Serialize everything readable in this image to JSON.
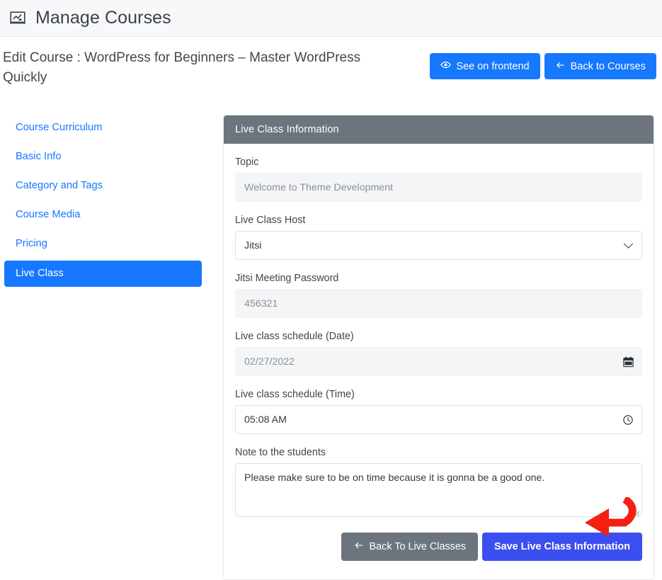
{
  "appbar": {
    "icon": "presentation-chart-icon",
    "title": "Manage Courses"
  },
  "page_header": {
    "title": "Edit Course : WordPress for Beginners – Master WordPress Quickly",
    "actions": [
      {
        "id": "see-on-frontend",
        "label": "See on frontend",
        "icon": "eye-icon",
        "color": "#1677ff"
      },
      {
        "id": "back-to-courses",
        "label": "Back to Courses",
        "icon": "arrow-left-icon",
        "color": "#1677ff"
      }
    ]
  },
  "sidebar": {
    "items": [
      {
        "label": "Course Curriculum",
        "active": false
      },
      {
        "label": "Basic Info",
        "active": false
      },
      {
        "label": "Category and Tags",
        "active": false
      },
      {
        "label": "Course Media",
        "active": false
      },
      {
        "label": "Pricing",
        "active": false
      },
      {
        "label": "Live Class",
        "active": true
      }
    ],
    "active_bg": "#1677ff",
    "link_color": "#1677ff"
  },
  "panel": {
    "header": "Live Class Information",
    "header_bg": "#6c757d",
    "fields": {
      "topic": {
        "label": "Topic",
        "value": "Welcome to Theme Development",
        "placeholder": "Welcome to Theme Development"
      },
      "host": {
        "label": "Live Class Host",
        "value": "Jitsi",
        "options": [
          "Jitsi"
        ],
        "icon": "chevron-down-icon"
      },
      "password": {
        "label": "Jitsi Meeting Password",
        "value": "456321",
        "placeholder": "456321"
      },
      "schedule_date": {
        "label": "Live class schedule (Date)",
        "value": "02/27/2022",
        "icon": "calendar-icon"
      },
      "schedule_time": {
        "label": "Live class schedule (Time)",
        "value": "05:08 AM",
        "icon": "clock-icon"
      },
      "note": {
        "label": "Note to the students",
        "value": "Please make sure to be on time because it is gonna be a good one."
      }
    },
    "actions": {
      "back": {
        "label": "Back To Live Classes",
        "icon": "arrow-left-icon",
        "color": "#6c757d"
      },
      "save": {
        "label": "Save Live Class Information",
        "color": "#3b4ef0"
      }
    }
  },
  "annotation": {
    "name": "red-arrow-pointing-to-save",
    "color": "#f42113"
  }
}
